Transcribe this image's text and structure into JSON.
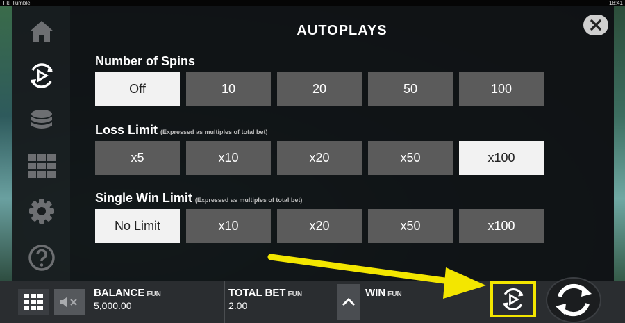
{
  "topbar": {
    "app_title": "Tiki Tumble",
    "clock": "18:41"
  },
  "sidebar": {
    "items": [
      {
        "name": "home-icon"
      },
      {
        "name": "autoplay-icon",
        "active": true
      },
      {
        "name": "coins-icon"
      },
      {
        "name": "paytable-grid-icon"
      },
      {
        "name": "gear-icon"
      },
      {
        "name": "help-icon"
      }
    ]
  },
  "panel": {
    "title": "AUTOPLAYS",
    "close_icon": "close-icon",
    "spins": {
      "label": "Number of Spins",
      "options": [
        "Off",
        "10",
        "20",
        "50",
        "100"
      ],
      "selected": "Off"
    },
    "loss_limit": {
      "label": "Loss Limit",
      "note": "(Expressed as multiples of total bet)",
      "options": [
        "x5",
        "x10",
        "x20",
        "x50",
        "x100"
      ],
      "selected": "x100"
    },
    "win_limit": {
      "label": "Single Win Limit",
      "note": "(Expressed as multiples of total bet)",
      "options": [
        "No Limit",
        "x10",
        "x20",
        "x50",
        "x100"
      ],
      "selected": "No Limit"
    }
  },
  "bottom": {
    "balance_label": "BALANCE",
    "balance_unit": "FUN",
    "balance_value": "5,000.00",
    "bet_label": "TOTAL BET",
    "bet_unit": "FUN",
    "bet_value": "2.00",
    "win_label": "WIN",
    "win_unit": "FUN"
  },
  "colors": {
    "highlight": "#f3e600",
    "selected_option": "#f2f2f2",
    "option": "#5b5b5b"
  }
}
